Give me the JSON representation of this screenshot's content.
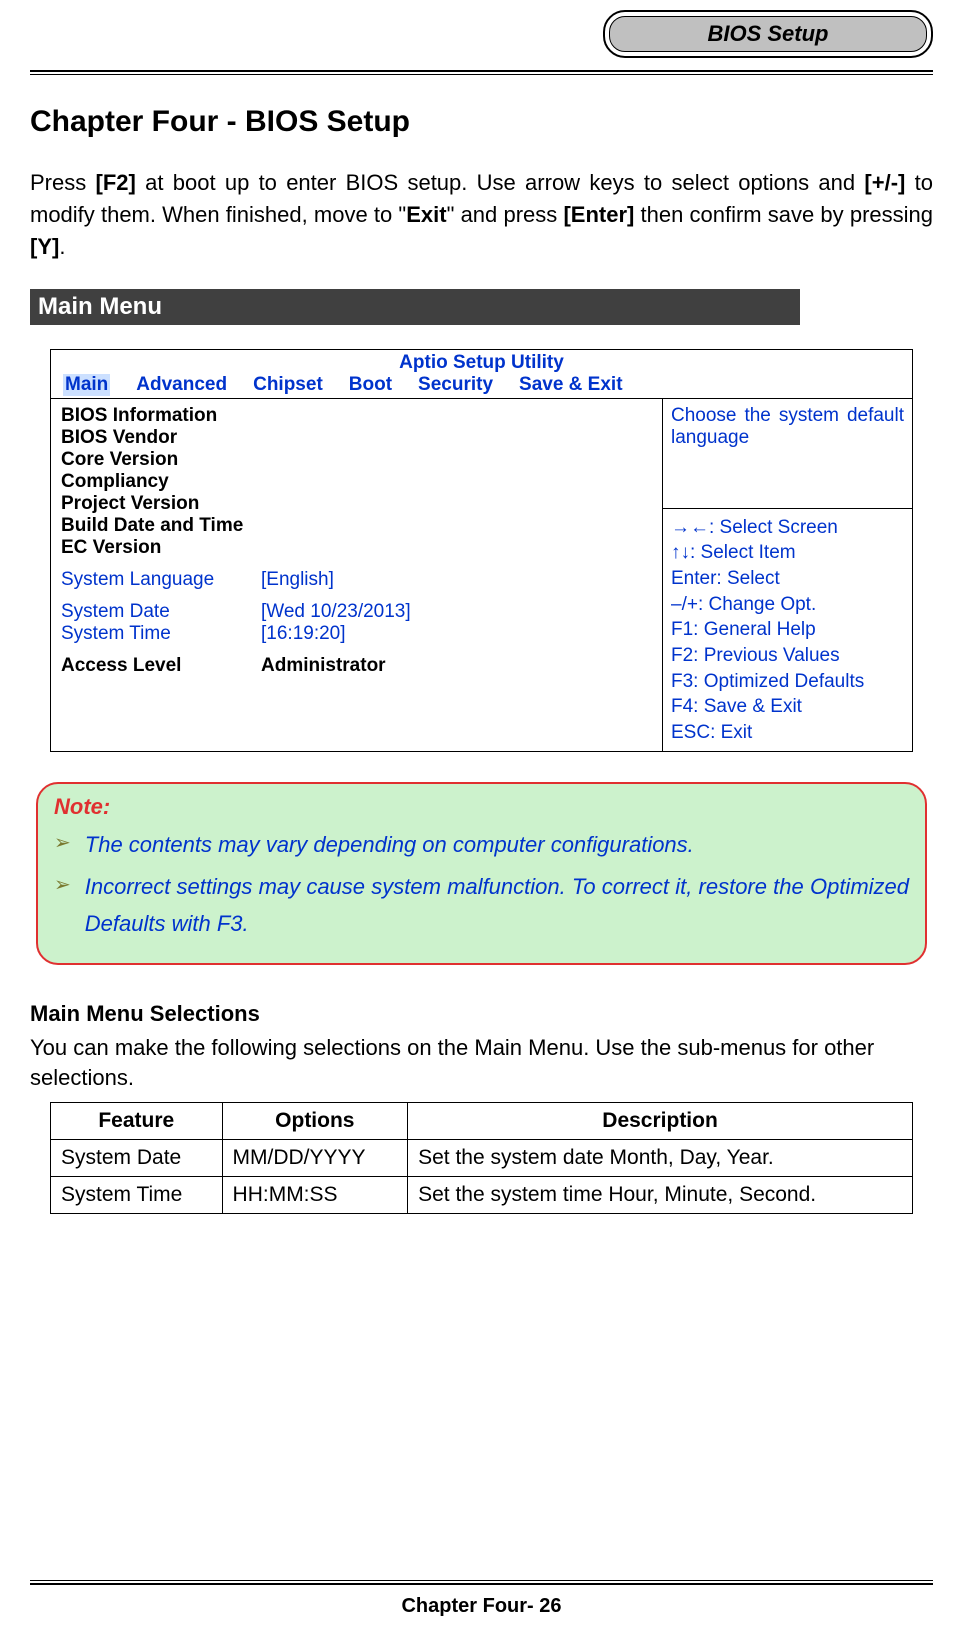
{
  "header": {
    "corner_title": "BIOS Setup"
  },
  "chapter_title": "Chapter Four - BIOS Setup",
  "intro": {
    "t1": "Press ",
    "b1": "[F2]",
    "t2": " at boot up to enter BIOS setup. Use arrow keys to select options and ",
    "b2": "[+/-]",
    "t3": " to modify them. When finished, move to \"",
    "b3": "Exit",
    "t4": "\" and press ",
    "b4": "[Enter]",
    "t5": " then confirm save by pressing ",
    "b5": "[Y]",
    "t6": "."
  },
  "section_bar": "Main Menu",
  "bios": {
    "title": "Aptio Setup Utility",
    "tabs": [
      "Main",
      "Advanced",
      "Chipset",
      "Boot",
      "Security",
      "Save & Exit"
    ],
    "info_labels": [
      "BIOS Information",
      "BIOS Vendor",
      "Core Version",
      "Compliancy",
      "Project Version",
      "Build Date and Time",
      "EC Version"
    ],
    "settings": [
      {
        "label": "System Language",
        "value": "[English]"
      },
      {
        "label": "System Date",
        "value": "[Wed 10/23/2013]"
      },
      {
        "label": "System Time",
        "value": "[16:19:20]"
      }
    ],
    "access": {
      "label": "Access Level",
      "value": "Administrator"
    },
    "help_top": "Choose the system default language",
    "help_keys": [
      "→←: Select Screen",
      "↑↓: Select Item",
      "Enter: Select",
      "–/+: Change Opt.",
      "F1: General Help",
      "F2: Previous Values",
      "F3: Optimized Defaults",
      "F4: Save & Exit",
      "ESC: Exit"
    ]
  },
  "note": {
    "title": "Note:",
    "items": [
      "The contents may vary depending on computer configurations.",
      "Incorrect settings may cause system malfunction. To correct it, restore the Optimized Defaults with F3."
    ]
  },
  "selections": {
    "heading": "Main Menu Selections",
    "text": "You can make the following selections on the Main Menu. Use the sub-menus for other selections.",
    "headers": [
      "Feature",
      "Options",
      "Description"
    ],
    "rows": [
      {
        "feature": "System Date",
        "options": "MM/DD/YYYY",
        "desc": "Set the system date Month, Day, Year."
      },
      {
        "feature": "System Time",
        "options": "HH:MM:SS",
        "desc": "Set the system time Hour, Minute, Second."
      }
    ]
  },
  "footer": "Chapter Four- 26"
}
